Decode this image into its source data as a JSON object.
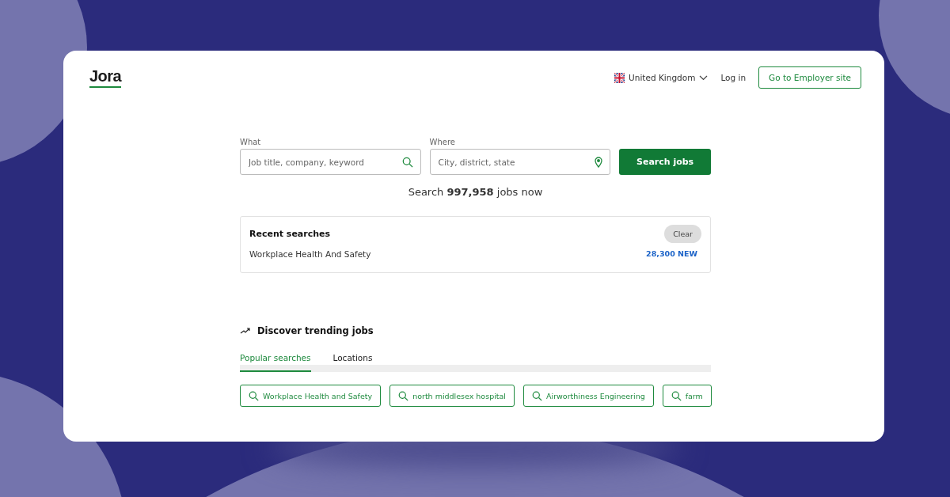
{
  "header": {
    "logo": "Jora",
    "country": "United Kingdom",
    "login": "Log in",
    "employer_button": "Go to Employer site"
  },
  "search": {
    "what_label": "What",
    "what_placeholder": "Job title, company, keyword",
    "where_label": "Where",
    "where_placeholder": "City, district, state",
    "button": "Search jobs",
    "tagline": "Search **997,958** jobs now"
  },
  "recent": {
    "title": "Recent searches",
    "clear": "Clear",
    "items": [
      {
        "query": "Workplace Health And Safety",
        "count": "28,300 NEW"
      }
    ]
  },
  "trending": {
    "title": "Discover trending jobs",
    "tabs": [
      {
        "label": "Popular searches",
        "selected": true
      },
      {
        "label": "Locations",
        "selected": false
      }
    ],
    "chips": [
      "Workplace Health and Safety",
      "north middlesex hospital",
      "Airworthiness Engineering",
      "farm"
    ]
  }
}
